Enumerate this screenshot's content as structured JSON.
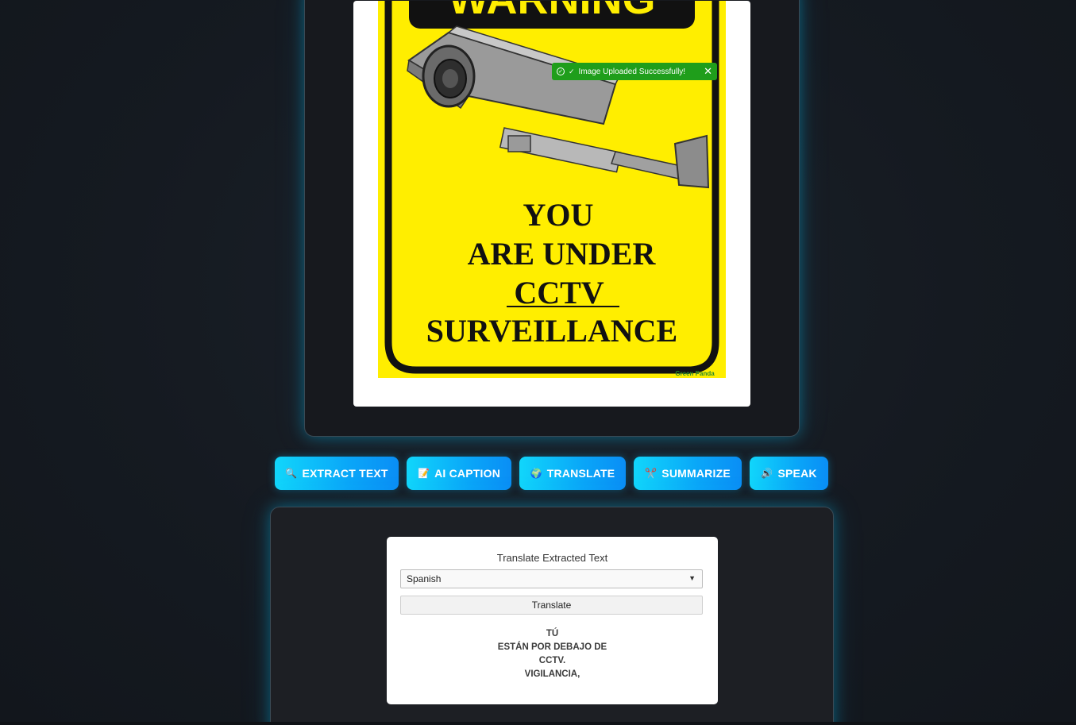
{
  "toast": {
    "message": "Image Uploaded Successfully!",
    "close_glyph": "✕"
  },
  "sign": {
    "header": "WARNING",
    "lines": [
      "YOU",
      "ARE UNDER",
      "CCTV",
      "SURVEILLANCE"
    ],
    "watermark": "Green Panda",
    "color": "#ffee00"
  },
  "actions": [
    {
      "label": "EXTRACT TEXT",
      "icon": "🔍"
    },
    {
      "label": "AI CAPTION",
      "icon": "📝"
    },
    {
      "label": "TRANSLATE",
      "icon": "🌍"
    },
    {
      "label": "SUMMARIZE",
      "icon": "✂️"
    },
    {
      "label": "SPEAK",
      "icon": "🔊"
    }
  ],
  "translate": {
    "title": "Translate Extracted Text",
    "selected_language": "Spanish",
    "button_label": "Translate",
    "output_lines": [
      "TÚ",
      "ESTÁN POR DEBAJO DE",
      "CCTV.",
      "VIGILANCIA,"
    ]
  },
  "colors": {
    "accent": "#0aa6f8",
    "toast": "#1f9e1b",
    "background": "#151a21"
  }
}
